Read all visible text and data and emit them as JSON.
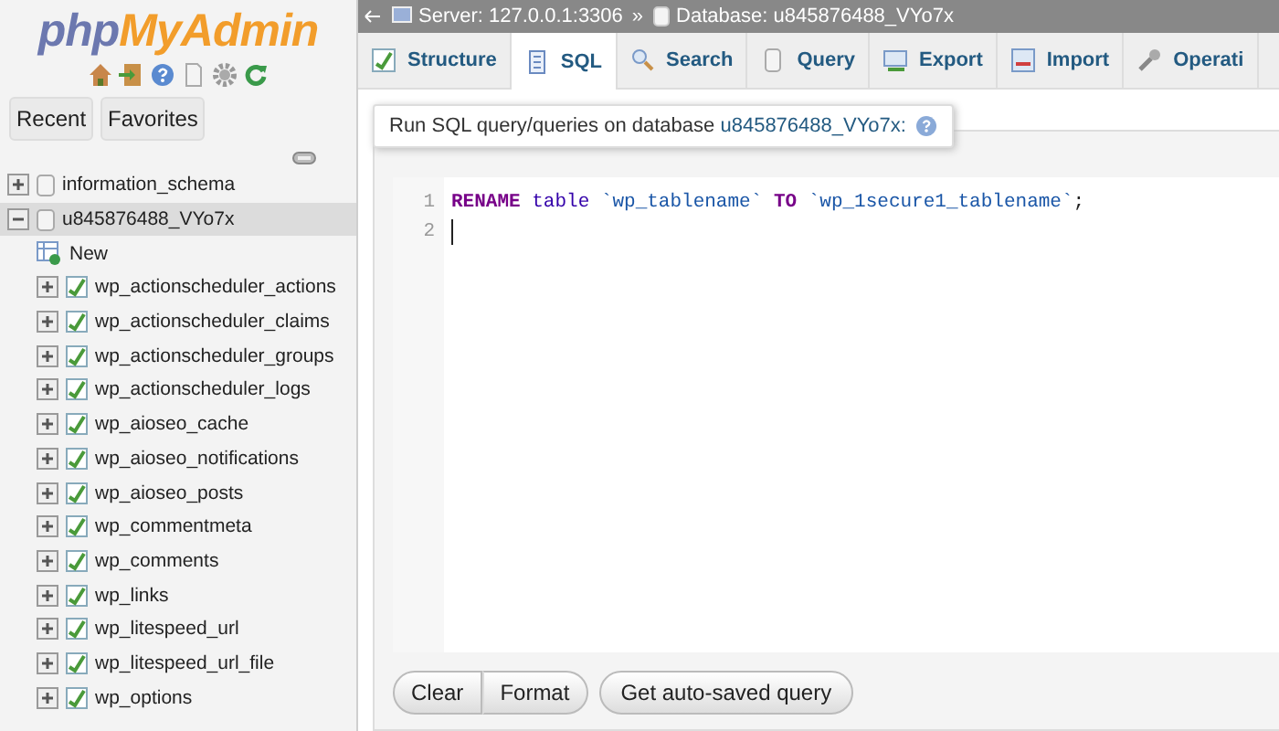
{
  "logo": {
    "part_1": "php",
    "part_2": "MyAdmin"
  },
  "sidebar": {
    "tabs": [
      {
        "label": "Recent"
      },
      {
        "label": "Favorites"
      }
    ],
    "tree": [
      {
        "label": "information_schema",
        "kind": "database",
        "expanded": false,
        "selected": false
      },
      {
        "label": "u845876488_VYo7x",
        "kind": "database",
        "expanded": true,
        "selected": true,
        "children": [
          {
            "label": "New",
            "kind": "new"
          },
          {
            "label": "wp_actionscheduler_actions",
            "kind": "table",
            "expanded": false
          },
          {
            "label": "wp_actionscheduler_claims",
            "kind": "table",
            "expanded": false
          },
          {
            "label": "wp_actionscheduler_groups",
            "kind": "table",
            "expanded": false
          },
          {
            "label": "wp_actionscheduler_logs",
            "kind": "table",
            "expanded": false
          },
          {
            "label": "wp_aioseo_cache",
            "kind": "table",
            "expanded": false
          },
          {
            "label": "wp_aioseo_notifications",
            "kind": "table",
            "expanded": false
          },
          {
            "label": "wp_aioseo_posts",
            "kind": "table",
            "expanded": false
          },
          {
            "label": "wp_commentmeta",
            "kind": "table",
            "expanded": false
          },
          {
            "label": "wp_comments",
            "kind": "table",
            "expanded": false
          },
          {
            "label": "wp_links",
            "kind": "table",
            "expanded": false
          },
          {
            "label": "wp_litespeed_url",
            "kind": "table",
            "expanded": false
          },
          {
            "label": "wp_litespeed_url_file",
            "kind": "table",
            "expanded": false
          },
          {
            "label": "wp_options",
            "kind": "table",
            "expanded": false
          }
        ]
      }
    ]
  },
  "breadcrumb": [
    {
      "label": "Server: 127.0.0.1:3306",
      "kind": "server"
    },
    {
      "label": "Database: u845876488_VYo7x",
      "kind": "database"
    }
  ],
  "breadcrumb_separator": "»",
  "tabs": [
    {
      "label": "Structure",
      "selected": false
    },
    {
      "label": "SQL",
      "selected": true
    },
    {
      "label": "Search",
      "selected": false
    },
    {
      "label": "Query",
      "selected": false
    },
    {
      "label": "Export",
      "selected": false
    },
    {
      "label": "Import",
      "selected": false
    },
    {
      "label": "Operati",
      "selected": false
    }
  ],
  "query_box": {
    "title": "Run SQL query/queries on database ",
    "database": "u845876488_VYo7x:",
    "lines": [
      {
        "number": "1",
        "tokens": [
          {
            "text": "RENAME",
            "kind": "keyword"
          },
          {
            "text": "table",
            "kind": "word"
          },
          {
            "text": "`wp_tablename`",
            "kind": "quoted"
          },
          {
            "text": "TO",
            "kind": "keyword"
          },
          {
            "text": "`wp_1secure1_tablename`",
            "kind": "quoted"
          },
          {
            "text": ";",
            "kind": "punct"
          }
        ]
      },
      {
        "number": "2",
        "cursor": true
      }
    ]
  },
  "buttons": [
    {
      "label": "Clear",
      "kind": "segment"
    },
    {
      "label": "Format",
      "kind": "segment"
    },
    {
      "label": "Get auto-saved query",
      "kind": "single"
    }
  ]
}
